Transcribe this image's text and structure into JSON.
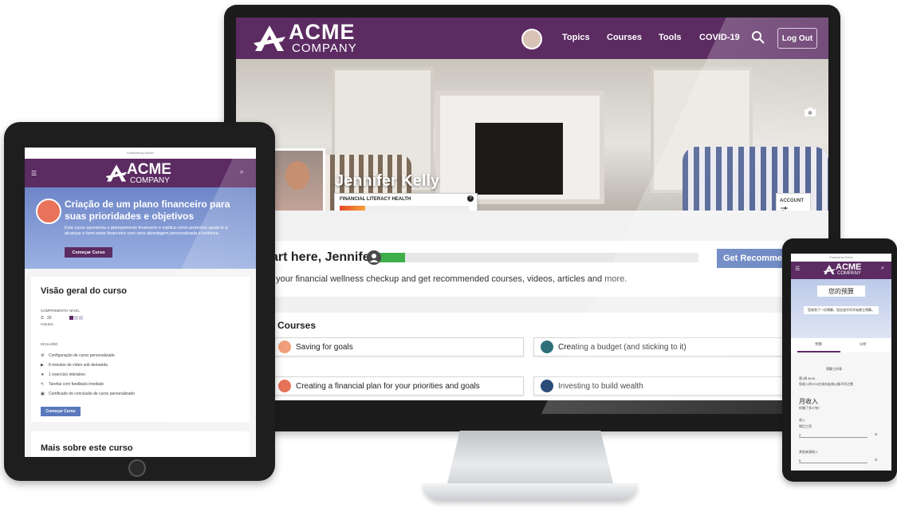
{
  "colors": {
    "brand_purple": "#5b2b62",
    "accent_blue": "#5a79bc",
    "progress_green": "#3fae4a",
    "progress_orange": "#e84b2a"
  },
  "desktop": {
    "logo": {
      "line1": "ACME",
      "line2": "COMPANY"
    },
    "nav": {
      "topics": "Topics",
      "courses": "Courses",
      "tools": "Tools",
      "covid": "COVID-19",
      "logout": "Log Out"
    },
    "profile": {
      "name": "Jennifer Kelly",
      "flh_label": "FINANCIAL LITERACY HEALTH",
      "flh_help": "?",
      "flh_progress": 0.2,
      "account_label": "ACCOUNT"
    },
    "start": {
      "heading": "art here, Jennifer",
      "progress": 0.08,
      "button": "Get Recommend",
      "desc": "t your financial wellness checkup and get recommended courses, videos, articles and more."
    },
    "courses": {
      "heading": "r Courses",
      "items": [
        {
          "label": "Saving for goals",
          "icon_color": "#f2a07b"
        },
        {
          "label": "Creating a budget (and sticking to it)",
          "icon_color": "#2f6f7a"
        },
        {
          "label": "Creating a financial plan for your priorities and goals",
          "icon_color": "#e8735a"
        },
        {
          "label": "Investing to build wealth",
          "icon_color": "#2c4d7a"
        }
      ]
    }
  },
  "tablet": {
    "powered_by": "Powered by Enrich",
    "logo": {
      "line1": "ACME",
      "line2": "COMPANY"
    },
    "hero": {
      "title": "Criação de um plano financeiro para suas prioridades e objetivos",
      "desc": "Este curso apresenta o planejamento financeiro e explica como podemos ajudá-lo a alcançar o bem-estar financeiro com uma abordagem personalizada e holística.",
      "button": "Começar Curso"
    },
    "overview": {
      "heading": "Visão geral do curso",
      "length_label": "COMPRIMENTO",
      "level_label": "NÍVEL",
      "length_value": "20",
      "length_unit": "minutos",
      "included_label": "INCLUÍDO",
      "items": [
        "Configuração de curso personalizado",
        "8 minutos de vídeo sob demanda",
        "1 exercício interativo",
        "Tarefas com feedback imediato",
        "Certificado de conclusão de curso personalizado"
      ],
      "button": "Começar Curso"
    },
    "more": {
      "heading": "Mais sobre este curso"
    }
  },
  "phone": {
    "powered_by": "Powered by Enrich",
    "logo": {
      "line1": "ACME",
      "line2": "COMPANY"
    },
    "hero": {
      "title": "您的预算",
      "subtitle": "您收到了一份预算。您应该尽早开始建立预算。"
    },
    "tabs": {
      "tab1": "预算",
      "tab2": "分析"
    },
    "body": {
      "section": "预算工作表",
      "note1": "第1周  $100",
      "note2": "您收入的20%应该存起来以备不时之需",
      "income_h": "月收入",
      "income_q": "你赚了多少钱?",
      "field1_label": "收入",
      "field1_sub": "税后工资",
      "field1_val": "¥",
      "field2_label": "其他来源收入",
      "field2_val": "¥"
    }
  }
}
